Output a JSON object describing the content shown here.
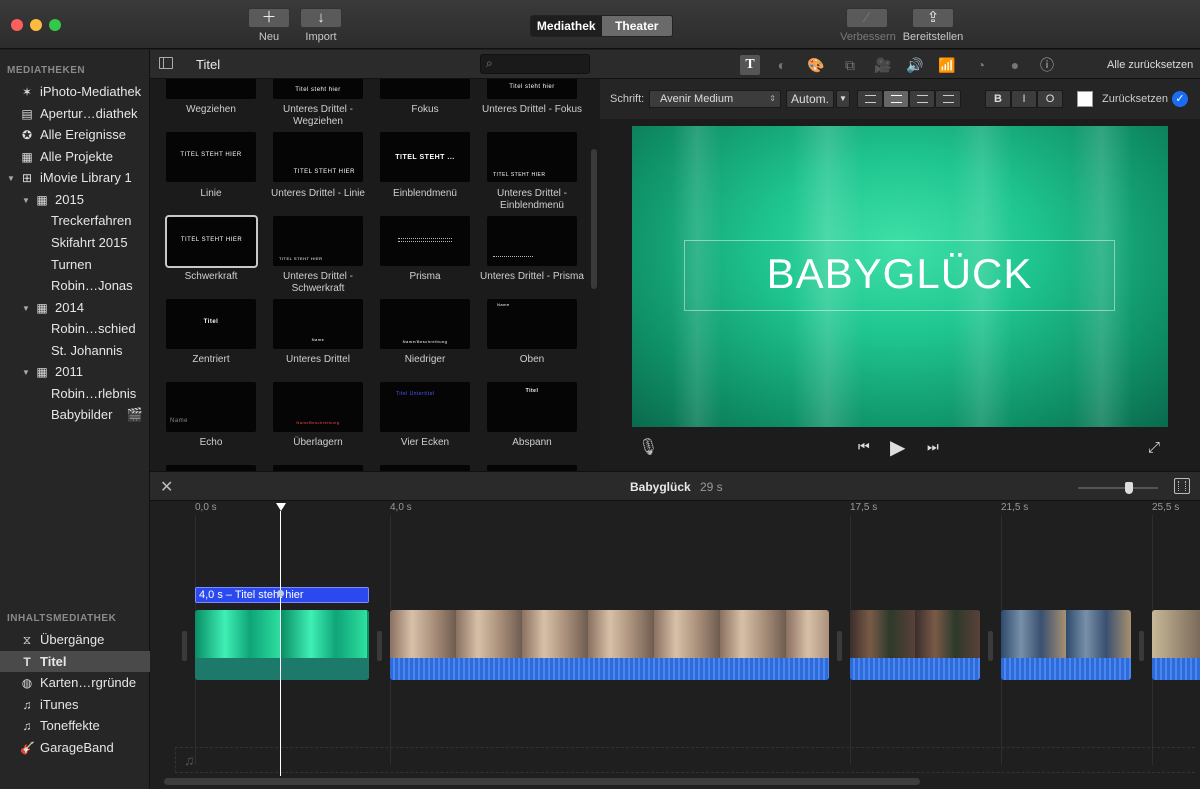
{
  "toolbar": {
    "new_label": "Neu",
    "import_label": "Import",
    "segment": [
      "Mediathek",
      "Theater"
    ],
    "enhance_label": "Verbessern",
    "share_label": "Bereitstellen",
    "new_icon": "plus-icon",
    "import_icon": "arrow-down-icon"
  },
  "sidebar": {
    "libraries_header": "MEDIATHEKEN",
    "items": [
      {
        "label": "iPhoto-Mediathek",
        "icon": "palm-icon"
      },
      {
        "label": "Apertur…diathek",
        "icon": "aperture-icon"
      },
      {
        "label": "Alle Ereignisse",
        "icon": "star-icon"
      },
      {
        "label": "Alle Projekte",
        "icon": "grid-icon"
      },
      {
        "label": "iMovie Library 1",
        "icon": "library-icon"
      },
      {
        "label": "2015",
        "icon": "calendar-icon"
      },
      {
        "label": "Treckerfahren"
      },
      {
        "label": "Skifahrt 2015"
      },
      {
        "label": "Turnen"
      },
      {
        "label": "Robin…Jonas"
      },
      {
        "label": "2014",
        "icon": "calendar-icon"
      },
      {
        "label": "Robin…schied"
      },
      {
        "label": "St. Johannis"
      },
      {
        "label": "2011",
        "icon": "calendar-icon"
      },
      {
        "label": "Robin…rlebnis"
      },
      {
        "label": "Babybilder",
        "icon": "clapper-icon"
      }
    ],
    "content_header": "INHALTSMEDIATHEK",
    "content_items": [
      {
        "label": "Übergänge",
        "icon": "transition-icon"
      },
      {
        "label": "Titel",
        "icon": "title-icon",
        "selected": true
      },
      {
        "label": "Karten…rgründe",
        "icon": "globe-icon"
      },
      {
        "label": "iTunes",
        "icon": "music-note-icon"
      },
      {
        "label": "Toneffekte",
        "icon": "music-note-icon"
      },
      {
        "label": "GarageBand",
        "icon": "guitar-icon"
      }
    ]
  },
  "browser": {
    "title": "Titel",
    "search_placeholder": "",
    "top_row": [
      "Wegziehen",
      "Unteres Drittel - Wegziehen",
      "Fokus",
      "Unteres Drittel - Fokus"
    ],
    "top_row_thumb": [
      "",
      "Titel steht hier",
      "",
      "Titel steht hier"
    ],
    "rows": [
      {
        "labels": [
          "Linie",
          "Unteres Drittel - Linie",
          "Einblendmenü",
          "Unteres Drittel - Einblendmenü"
        ],
        "thumbs": [
          "TITEL STEHT HIER",
          "TITEL STEHT HIER",
          "TITEL STEHT ...",
          "TITEL STEHT HIER"
        ]
      },
      {
        "labels": [
          "Schwerkraft",
          "Unteres Drittel - Schwerkraft",
          "Prisma",
          "Unteres Drittel - Prisma"
        ],
        "thumbs": [
          "TITEL STEHT HIER",
          "TITEL STEHT HIER",
          "",
          ""
        ]
      },
      {
        "labels": [
          "Zentriert",
          "Unteres Drittel",
          "Niedriger",
          "Oben"
        ],
        "thumbs": [
          "Titel",
          "Name",
          "Name/Beschreibung",
          "Name"
        ]
      },
      {
        "labels": [
          "Echo",
          "Überlagern",
          "Vier Ecken",
          "Abspann"
        ],
        "thumbs": [
          "Name",
          "NameBeschreibung",
          "Titel Untertitel",
          "Titel"
        ]
      }
    ]
  },
  "viewer": {
    "reset_all": "Alle zurücksetzen",
    "font_label": "Schrift:",
    "font_value": "Avenir Medium",
    "size_value": "Autom.",
    "style_b": "B",
    "style_i": "I",
    "style_o": "O",
    "reset": "Zurücksetzen",
    "title_text": "BABYGLÜCK",
    "tools": [
      "T",
      "◐",
      "🎨",
      "⧉",
      "🎥",
      "🔊",
      "📶",
      "◔",
      "●",
      "ⓘ"
    ]
  },
  "timeline": {
    "project_name": "Babyglück",
    "duration": "29 s",
    "ruler": [
      "0,0 s",
      "4,0 s",
      "17,5 s",
      "21,5 s",
      "25,5 s"
    ],
    "title_clip": "4,0 s – Titel steht hier"
  },
  "colors": {
    "accent": "#1a6cf0",
    "title_green": "#1fc58f",
    "selected_sidebar": "#4a4a4a"
  }
}
